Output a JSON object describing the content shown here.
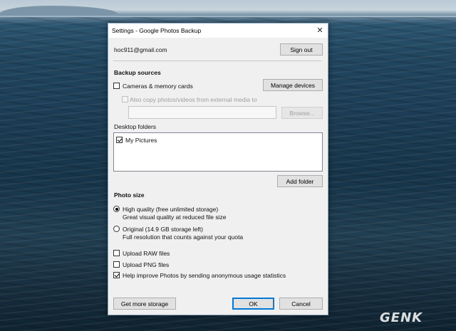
{
  "window": {
    "title": "Settings - Google Photos Backup"
  },
  "account": {
    "email": "hoc911@gmail.com",
    "sign_out_label": "Sign out"
  },
  "backup_sources": {
    "heading": "Backup sources",
    "cameras_label": "Cameras & memory cards",
    "cameras_checked": false,
    "manage_devices_label": "Manage devices",
    "external_media_label": "Also copy photos/videos from external media to",
    "external_media_checked": false,
    "external_media_path": "",
    "browse_label": "Browse..."
  },
  "desktop_folders": {
    "heading": "Desktop folders",
    "items": [
      {
        "label": "My Pictures",
        "checked": true
      }
    ],
    "add_folder_label": "Add folder"
  },
  "photo_size": {
    "heading": "Photo size",
    "options": [
      {
        "label": "High quality (free unlimited storage)",
        "desc": "Great visual quality at reduced file size",
        "selected": true
      },
      {
        "label": "Original (14.9 GB storage left)",
        "desc": "Full resolution that counts against your quota",
        "selected": false
      }
    ]
  },
  "options": {
    "upload_raw_label": "Upload RAW files",
    "upload_raw_checked": false,
    "upload_png_label": "Upload PNG files",
    "upload_png_checked": false,
    "help_improve_label": "Help improve Photos by sending anonymous usage statistics",
    "help_improve_checked": true
  },
  "footer": {
    "get_more_storage_label": "Get more storage",
    "ok_label": "OK",
    "cancel_label": "Cancel"
  },
  "watermark": {
    "text": "GENK"
  }
}
